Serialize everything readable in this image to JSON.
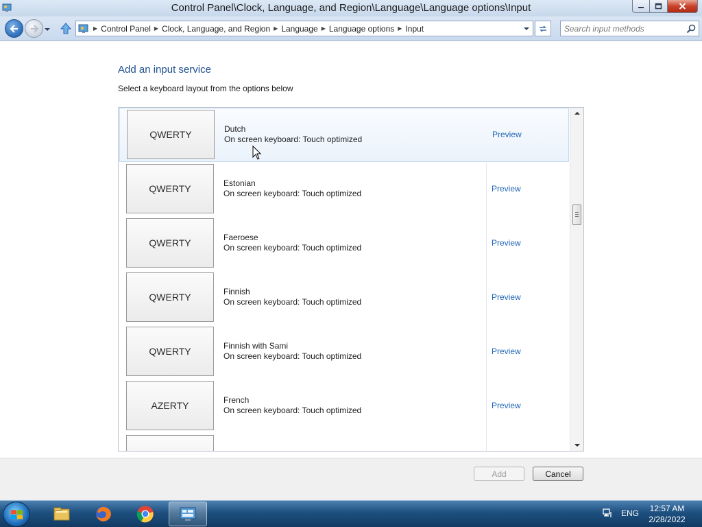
{
  "window": {
    "title": "Control Panel\\Clock, Language, and Region\\Language\\Language options\\Input",
    "minimize_icon": "minimize-icon",
    "maximize_icon": "maximize-icon",
    "close_icon": "close-icon"
  },
  "address_bar": {
    "breadcrumbs": [
      "Control Panel",
      "Clock, Language, and Region",
      "Language",
      "Language options",
      "Input"
    ],
    "search_placeholder": "Search input methods"
  },
  "page": {
    "heading": "Add an input service",
    "subheading": "Select a keyboard layout from the options below"
  },
  "layouts": [
    {
      "tile": "QWERTY",
      "name": "Dutch",
      "description": "On screen keyboard: Touch optimized",
      "preview": "Preview",
      "selected": true
    },
    {
      "tile": "QWERTY",
      "name": "Estonian",
      "description": "On screen keyboard: Touch optimized",
      "preview": "Preview"
    },
    {
      "tile": "QWERTY",
      "name": "Faeroese",
      "description": "On screen keyboard: Touch optimized",
      "preview": "Preview"
    },
    {
      "tile": "QWERTY",
      "name": "Finnish",
      "description": "On screen keyboard: Touch optimized",
      "preview": "Preview"
    },
    {
      "tile": "QWERTY",
      "name": "Finnish with Sami",
      "description": "On screen keyboard: Touch optimized",
      "preview": "Preview"
    },
    {
      "tile": "AZERTY",
      "name": "French",
      "description": "On screen keyboard: Touch optimized",
      "preview": "Preview"
    }
  ],
  "footer": {
    "add_label": "Add",
    "add_enabled": false,
    "cancel_label": "Cancel"
  },
  "taskbar": {
    "apps": [
      "file-explorer-icon",
      "firefox-icon",
      "chrome-icon",
      "control-panel-icon"
    ],
    "active_app": "control-panel-icon",
    "language": "ENG",
    "time": "12:57 AM",
    "date": "2/28/2022"
  },
  "colors": {
    "heading": "#1e4f8e",
    "link": "#1f64b4",
    "selected_row": "#eaf2fb",
    "taskbar": "#1d4f7f"
  }
}
